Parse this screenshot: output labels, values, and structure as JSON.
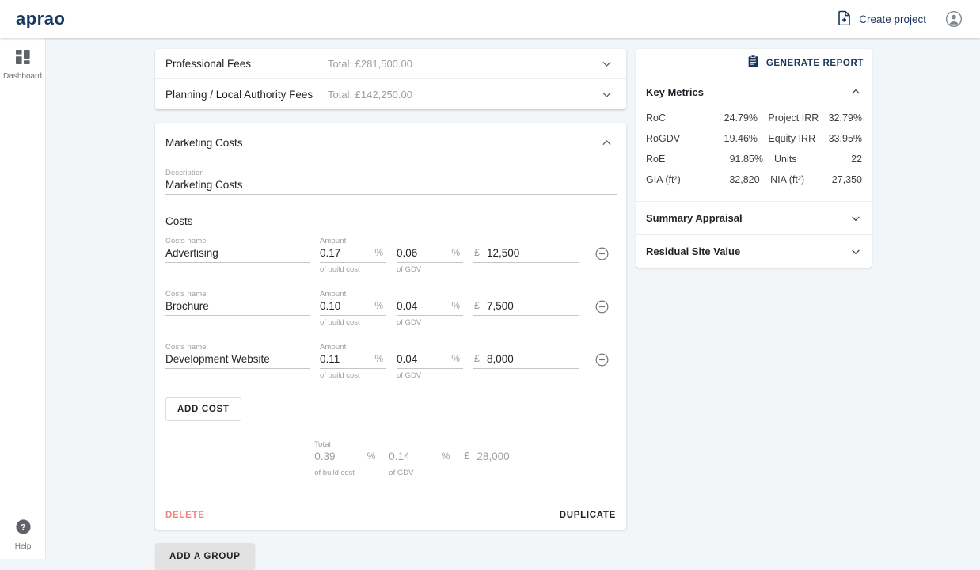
{
  "header": {
    "logo": "aprao",
    "create_project_label": "Create project",
    "create_project_icon": "file-plus-icon",
    "avatar_icon": "account-circle-icon"
  },
  "sidebar": {
    "items": [
      {
        "label": "Dashboard",
        "icon": "dashboard-grid-icon"
      }
    ],
    "bottom": {
      "label": "Help",
      "icon": "help-circle-icon"
    }
  },
  "collapsed_groups": [
    {
      "title": "Professional Fees",
      "total": "Total: £281,500.00",
      "icon": "chevron-down-icon"
    },
    {
      "title": "Planning / Local Authority Fees",
      "total": "Total: £142,250.00",
      "icon": "chevron-down-icon"
    }
  ],
  "group": {
    "title": "Marketing Costs",
    "collapse_icon": "chevron-up-icon",
    "description": {
      "label": "Description",
      "value": "Marketing Costs",
      "placeholder": "Description"
    },
    "costs_heading": "Costs",
    "labels": {
      "costs_name": "Costs name",
      "amount": "Amount",
      "of_build_cost": "of build cost",
      "of_gdv": "of GDV",
      "percent_symbol": "%",
      "currency_symbol": "£",
      "total": "Total"
    },
    "rows": [
      {
        "name": "Advertising",
        "pct_build": "0.17",
        "pct_gdv": "0.06",
        "amount": "12,500",
        "remove_icon": "minus-circle-icon"
      },
      {
        "name": "Brochure",
        "pct_build": "0.10",
        "pct_gdv": "0.04",
        "amount": "7,500",
        "remove_icon": "minus-circle-icon"
      },
      {
        "name": "Development Website",
        "pct_build": "0.11",
        "pct_gdv": "0.04",
        "amount": "8,000",
        "remove_icon": "minus-circle-icon"
      }
    ],
    "add_cost_label": "ADD COST",
    "total_row": {
      "pct_build": "0.39",
      "pct_gdv": "0.14",
      "amount": "28,000"
    },
    "delete_label": "DELETE",
    "duplicate_label": "DUPLICATE"
  },
  "add_group_label": "ADD A GROUP",
  "right_panel": {
    "generate_report_label": "GENERATE REPORT",
    "generate_report_icon": "clipboard-icon",
    "key_metrics": {
      "title": "Key Metrics",
      "collapse_icon": "chevron-up-icon",
      "rows": [
        {
          "k1": "RoC",
          "v1": "24.79%",
          "k2": "Project IRR",
          "v2": "32.79%"
        },
        {
          "k1": "RoGDV",
          "v1": "19.46%",
          "k2": "Equity IRR",
          "v2": "33.95%"
        },
        {
          "k1": "RoE",
          "v1": "91.85%",
          "k2": "Units",
          "v2": "22"
        },
        {
          "k1": "GIA (ft²)",
          "v1": "32,820",
          "k2": "NIA (ft²)",
          "v2": "27,350"
        }
      ]
    },
    "sections": [
      {
        "title": "Summary Appraisal",
        "icon": "chevron-down-icon"
      },
      {
        "title": "Residual Site Value",
        "icon": "chevron-down-icon"
      }
    ]
  },
  "colors": {
    "brand_navy": "#17355c",
    "page_bg": "#f3f6f9",
    "delete_red": "#f4847f",
    "muted_text": "#9aa0a6"
  }
}
